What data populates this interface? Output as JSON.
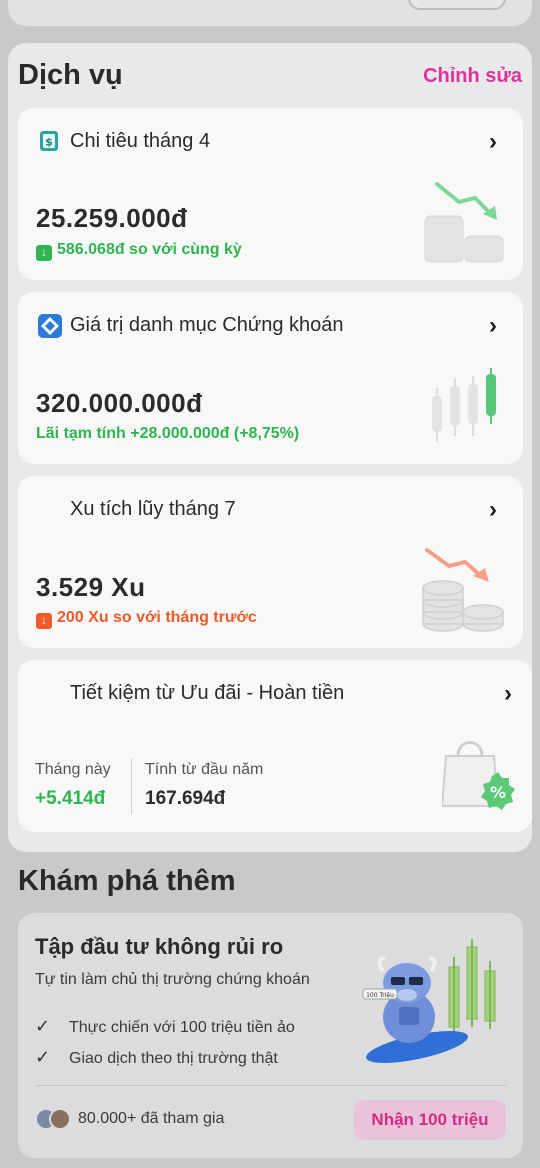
{
  "services": {
    "title": "Dịch vụ",
    "edit_label": "Chỉnh sửa",
    "spending": {
      "title": "Chi tiêu tháng 4",
      "value": "25.259.000đ",
      "compare": "586.068đ so với cùng kỳ",
      "trend_color": "#2fb450",
      "icon": "dollar-bill-icon"
    },
    "portfolio": {
      "title": "Giá trị danh mục Chứng khoán",
      "value": "320.000.000đ",
      "profit": "Lãi tạm tính +28.000.000đ (+8,75%)",
      "icon": "stock-app-icon"
    },
    "coins": {
      "title": "Xu tích lũy tháng 7",
      "value": "3.529 Xu",
      "compare": "200 Xu so với tháng trước",
      "trend_color": "#ef5a28"
    },
    "savings": {
      "title": "Tiết kiệm từ Ưu đãi - Hoàn tiền",
      "this_month_label": "Tháng này",
      "this_month_value": "+5.414đ",
      "ytd_label": "Tính từ đầu năm",
      "ytd_value": "167.694đ"
    }
  },
  "explore": {
    "title": "Khám phá thêm",
    "promo": {
      "title": "Tập đầu tư không rủi ro",
      "subtitle": "Tự tin làm chủ thị trường chứng khoán",
      "bullets": [
        "Thực chiến với 100 triệu tiền ảo",
        "Giao dịch theo thị trường thật"
      ],
      "joined": "80.000+ đã tham gia",
      "cta": "Nhận 100 triệu",
      "mascot_label": "100 Triệu"
    }
  },
  "colors": {
    "accent": "#e0329c",
    "green": "#2fb450",
    "orange": "#ef5a28"
  }
}
